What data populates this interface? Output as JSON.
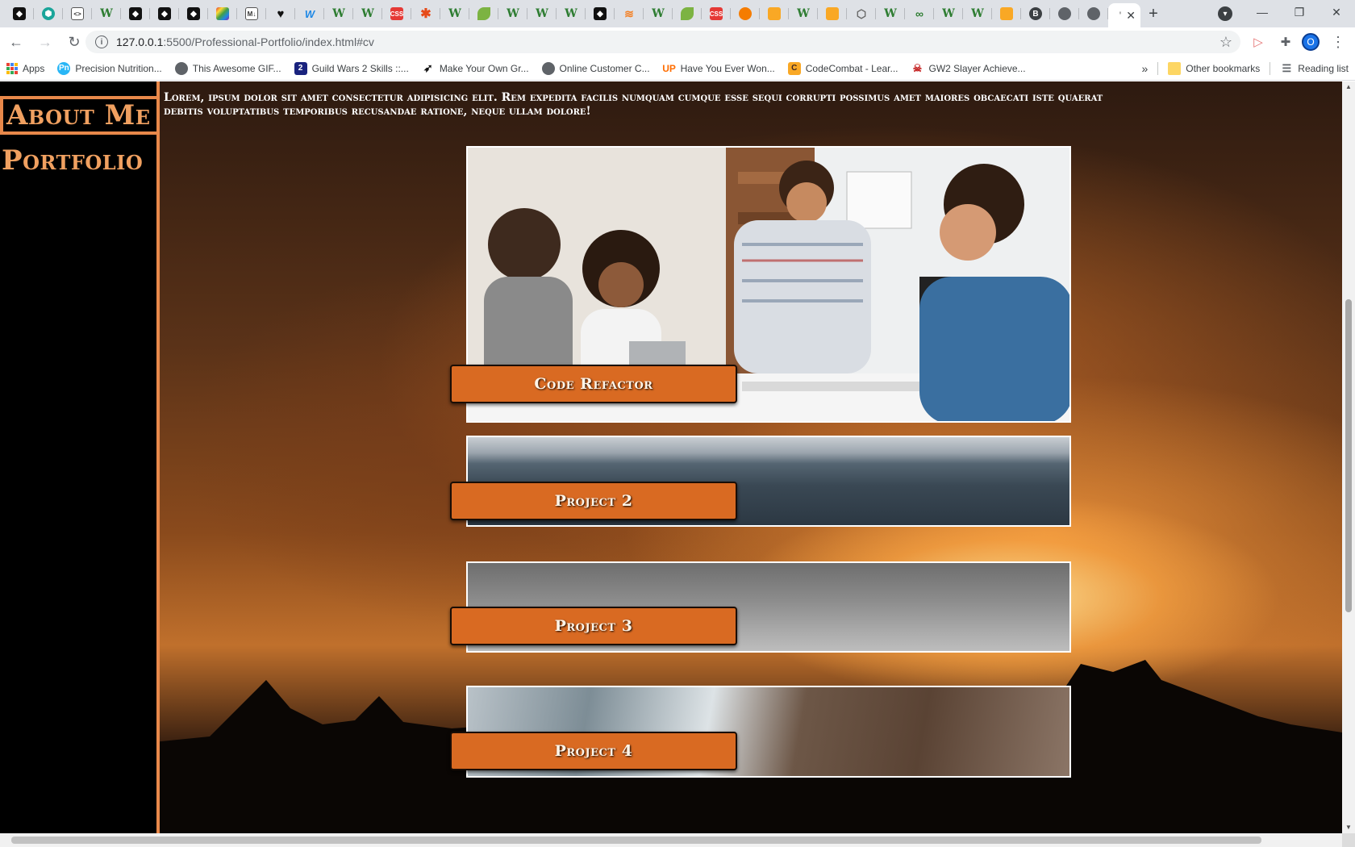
{
  "browser": {
    "tabs": [
      {
        "icon": "square-logo-icon"
      },
      {
        "icon": "shield-icon"
      },
      {
        "icon": "code-icon"
      },
      {
        "icon": "w-icon"
      },
      {
        "icon": "square-logo-icon"
      },
      {
        "icon": "square-logo-icon"
      },
      {
        "icon": "square-logo-icon"
      },
      {
        "icon": "rainbow-icon"
      },
      {
        "icon": "markdown-icon"
      },
      {
        "icon": "heart-icon"
      },
      {
        "icon": "vw-icon"
      },
      {
        "icon": "w-icon"
      },
      {
        "icon": "w-icon"
      },
      {
        "icon": "css-icon"
      },
      {
        "icon": "asterisk-icon"
      },
      {
        "icon": "w-icon"
      },
      {
        "icon": "leaf-icon"
      },
      {
        "icon": "w-icon"
      },
      {
        "icon": "w-icon"
      },
      {
        "icon": "w-icon"
      },
      {
        "icon": "square-logo-icon"
      },
      {
        "icon": "stack-icon"
      },
      {
        "icon": "w-icon"
      },
      {
        "icon": "leaf-icon"
      },
      {
        "icon": "css-icon"
      },
      {
        "icon": "firefox-icon"
      },
      {
        "icon": "lock-icon"
      },
      {
        "icon": "w-icon"
      },
      {
        "icon": "lock-icon"
      },
      {
        "icon": "cube-icon"
      },
      {
        "icon": "w-icon"
      },
      {
        "icon": "infinity-icon"
      },
      {
        "icon": "w-icon"
      },
      {
        "icon": "w-icon"
      },
      {
        "icon": "lock-icon"
      },
      {
        "icon": "b-circle-icon"
      },
      {
        "icon": "globe-icon"
      },
      {
        "icon": "globe-icon"
      }
    ],
    "active_tab": {
      "title_fragment": "'",
      "close": "✕"
    },
    "new_tab": "+",
    "window": {
      "minimize": "—",
      "restore": "❐",
      "close": "✕"
    },
    "url_host": "127.0.0.1",
    "url_rest": ":5500/Professional-Portfolio/index.html#cv",
    "profile_initial": "O",
    "bookmarks": [
      {
        "label": "Apps",
        "icon": "apps-grid-icon"
      },
      {
        "label": "Precision Nutrition...",
        "icon": "pn-icon",
        "color": "#29b6f6"
      },
      {
        "label": "This Awesome GIF...",
        "icon": "globe-icon",
        "color": "#5f6368"
      },
      {
        "label": "Guild Wars 2 Skills ::...",
        "icon": "gw2-icon",
        "color": "#1a237e"
      },
      {
        "label": "Make Your Own Gr...",
        "icon": "rocket-icon",
        "color": "#111111"
      },
      {
        "label": "Online Customer C...",
        "icon": "globe-icon",
        "color": "#5f6368"
      },
      {
        "label": "Have You Ever Won...",
        "icon": "up-icon",
        "color": "#ff6d00"
      },
      {
        "label": "CodeCombat - Lear...",
        "icon": "codecombat-icon",
        "color": "#f9a825"
      },
      {
        "label": "GW2 Slayer Achieve...",
        "icon": "slayer-icon",
        "color": "#c62828"
      }
    ],
    "bookmarks_overflow": "»",
    "other_bookmarks": "Other bookmarks",
    "reading_list": "Reading list"
  },
  "page": {
    "sidebar": {
      "about": "About Me",
      "portfolio": "Portfolio"
    },
    "intro": "Lorem, ipsum dolor sit amet consectetur adipisicing elit. Rem expedita facilis numquam cumque esse sequi corrupti possimus amet maiores obcaecati iste quaerat debitis voluptatibus temporibus recusandae ratione, neque ullam dolore!",
    "projects": [
      {
        "title": "Code Refactor",
        "image": "team-meeting-photo"
      },
      {
        "title": "Project 2",
        "image": "stormy-clouds-photo"
      },
      {
        "title": "Project 3",
        "image": "grey-sky-photo"
      },
      {
        "title": "Project 4",
        "image": "waves-on-rocks-photo"
      }
    ],
    "colors": {
      "accent": "#e8884a",
      "button": "#d96a22",
      "sidebar": "#000000"
    }
  }
}
